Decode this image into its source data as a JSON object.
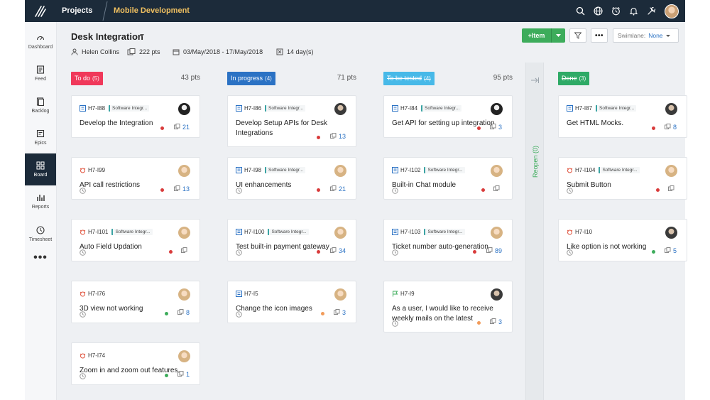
{
  "topbar": {
    "projects_label": "Projects",
    "project_name": "Mobile Development",
    "icons": [
      "search-icon",
      "globe-icon",
      "alarm-icon",
      "bell-icon",
      "tools-icon",
      "user-avatar"
    ]
  },
  "sidebar": {
    "items": [
      {
        "label": "Dashboard",
        "icon": "dashboard-icon"
      },
      {
        "label": "Feed",
        "icon": "feed-icon"
      },
      {
        "label": "Backlog",
        "icon": "backlog-icon"
      },
      {
        "label": "Epics",
        "icon": "epics-icon"
      },
      {
        "label": "Board",
        "icon": "board-icon",
        "active": true
      },
      {
        "label": "Reports",
        "icon": "reports-icon"
      },
      {
        "label": "Timesheet",
        "icon": "timesheet-icon"
      }
    ],
    "more": "•••"
  },
  "header": {
    "title": "Desk Integration",
    "owner": "Helen Collins",
    "points": "222 pts",
    "date_range": "03/May/2018 - 17/May/2018",
    "duration": "14 day(s)"
  },
  "toolbar": {
    "add_label": "Item",
    "more_label": "•••",
    "swimlane_label": "Swimlane:",
    "swimlane_value": "None"
  },
  "colors": {
    "todo": "#f0385a",
    "in_progress": "#2b72c4",
    "to_be_tested": "#47b9e8",
    "done": "#2eaa66",
    "priority_red": "#d93b3b",
    "priority_green": "#3dac5b",
    "priority_orange": "#f29b5a"
  },
  "columns": [
    {
      "title": "To do",
      "count": "(5)",
      "points": "43 pts",
      "cards": [
        {
          "id": "H7-I88",
          "type": "story",
          "chip": "Software Integr...",
          "title": "Develop the Integration",
          "avatar": "dark",
          "priority": "red",
          "points": "21",
          "clock": false
        },
        {
          "id": "H7-I99",
          "type": "bug",
          "chip": "",
          "title": "API call restrictions",
          "avatar": "female",
          "priority": "red",
          "points": "13",
          "clock": true
        },
        {
          "id": "H7-I101",
          "type": "bug",
          "chip": "Software Integr...",
          "title": "Auto Field Updation",
          "avatar": "female",
          "priority": "red",
          "points": "",
          "clock": true
        },
        {
          "id": "H7-I76",
          "type": "bug",
          "chip": "",
          "title": "3D view not working",
          "avatar": "female",
          "priority": "green",
          "points": "8",
          "clock": true
        },
        {
          "id": "H7-I74",
          "type": "bug",
          "chip": "",
          "title": "Zoom in and zoom out features.",
          "avatar": "female",
          "priority": "green",
          "points": "1",
          "clock": true
        }
      ]
    },
    {
      "title": "In progress",
      "count": "(4)",
      "points": "71 pts",
      "cards": [
        {
          "id": "H7-I86",
          "type": "story",
          "chip": "Software Integr...",
          "title": "Develop Setup APIs for Desk Integrations",
          "avatar": "male",
          "priority": "red",
          "points": "13",
          "clock": false
        },
        {
          "id": "H7-I98",
          "type": "story",
          "chip": "Software Integr...",
          "title": "UI enhancements",
          "avatar": "female",
          "priority": "red",
          "points": "21",
          "clock": true
        },
        {
          "id": "H7-I100",
          "type": "story",
          "chip": "Software Integr...",
          "title": "Test built-in payment gateway",
          "avatar": "female",
          "priority": "red",
          "points": "34",
          "clock": true
        },
        {
          "id": "H7-I5",
          "type": "story",
          "chip": "",
          "title": "Change the icon images",
          "avatar": "female",
          "priority": "orange",
          "points": "3",
          "clock": true
        }
      ]
    },
    {
      "title": "To be tested",
      "count": "(4)",
      "points": "95 pts",
      "cards": [
        {
          "id": "H7-I84",
          "type": "story",
          "chip": "Software Integr...",
          "title": "Get API for setting up integration",
          "avatar": "dark",
          "priority": "red",
          "points": "3",
          "clock": false
        },
        {
          "id": "H7-I102",
          "type": "story",
          "chip": "Software Integr...",
          "title": "Built-in Chat module",
          "avatar": "female",
          "priority": "red",
          "points": "",
          "clock": true
        },
        {
          "id": "H7-I103",
          "type": "story",
          "chip": "Software Integr...",
          "title": "Ticket number auto-generation",
          "avatar": "female",
          "priority": "red",
          "points": "89",
          "clock": true
        },
        {
          "id": "H7-I9",
          "type": "flag",
          "chip": "",
          "title": "As a user, I would like to receive weekly mails on the latest",
          "avatar": "male",
          "priority": "orange",
          "points": "3",
          "clock": true
        }
      ]
    },
    {
      "title": "Done",
      "count": "(3)",
      "points": "",
      "cards": [
        {
          "id": "H7-I87",
          "type": "story",
          "chip": "Software Integr...",
          "title": "Get HTML Mocks.",
          "avatar": "male",
          "priority": "red",
          "points": "8",
          "clock": false
        },
        {
          "id": "H7-I104",
          "type": "bug",
          "chip": "Software Integr...",
          "title": "Submit Button",
          "avatar": "female",
          "priority": "red",
          "points": "",
          "clock": true
        },
        {
          "id": "H7-I10",
          "type": "bug",
          "chip": "",
          "title": "Like option is not working",
          "avatar": "male",
          "priority": "green",
          "points": "5",
          "clock": true
        }
      ]
    }
  ],
  "reopen": {
    "label": "Reopen (0)"
  }
}
